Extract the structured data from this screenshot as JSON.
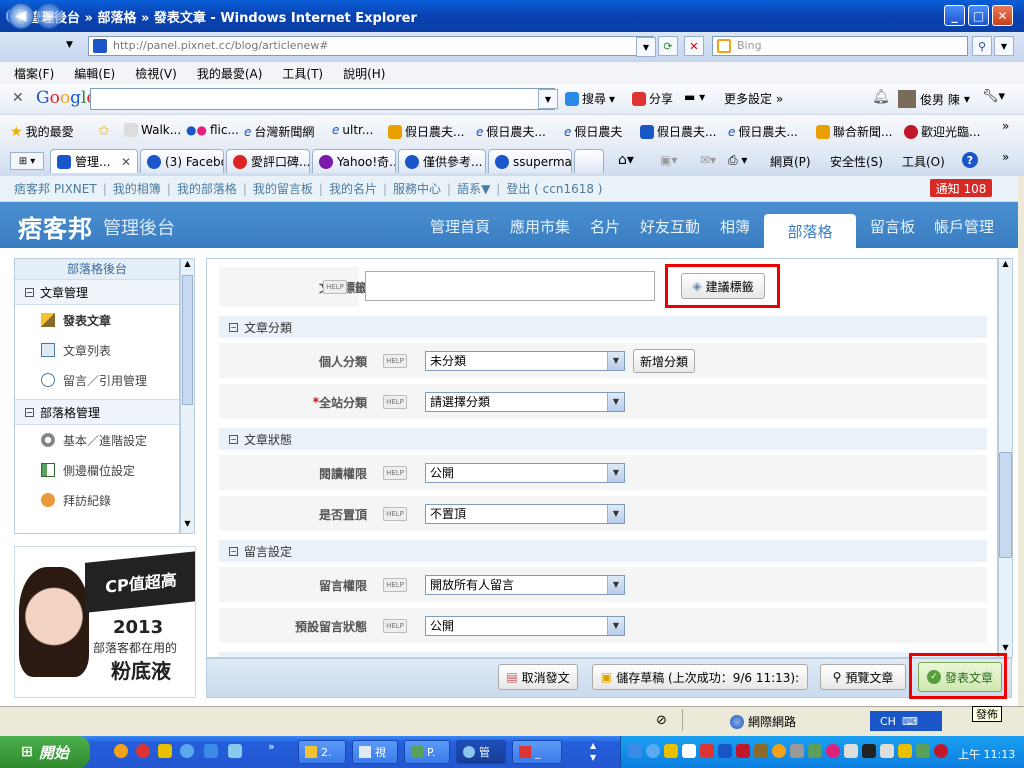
{
  "window": {
    "title": "管理後台 » 部落格 » 發表文章 - Windows Internet Explorer"
  },
  "address": {
    "url": "http://panel.pixnet.cc/blog/articlenew#",
    "search_placeholder": "Bing"
  },
  "menu": [
    "檔案(F)",
    "編輯(E)",
    "檢視(V)",
    "我的最愛(A)",
    "工具(T)",
    "說明(H)"
  ],
  "google_toolbar": {
    "logo": "Google",
    "search_label": "搜尋",
    "share_label": "分享",
    "more_label": "更多設定 »",
    "user_label": "俊男 陳"
  },
  "favorites": {
    "label": "我的最愛",
    "items": [
      "Walk...",
      "flic...",
      "台灣新聞網",
      "ultr...",
      "假日農夫...",
      "假日農夫...",
      "假日農夫",
      "假日農夫...",
      "假日農夫...",
      "聯合新聞...",
      "歡迎光臨..."
    ]
  },
  "tabs": [
    "管理...",
    "(3) Facebo...",
    "愛評口碑...",
    "Yahoo!奇...",
    "僅供參考...",
    "ssuperma..."
  ],
  "ie_commands": {
    "page": "網頁(P)",
    "safety": "安全性(S)",
    "tools": "工具(O)"
  },
  "pixnet_top": {
    "links": [
      "痞客邦 PIXNET",
      "我的相簿",
      "我的部落格",
      "我的留言板",
      "我的名片",
      "服務中心",
      "語系▼",
      "登出 ( ccn1618 )"
    ],
    "notice": "通知 108"
  },
  "pixnet_header": {
    "logo": "痞客邦",
    "subtitle": "管理後台",
    "nav": [
      "管理首頁",
      "應用市集",
      "名片",
      "好友互動",
      "相簿",
      "部落格",
      "留言板",
      "帳戶管理"
    ],
    "active_nav": "部落格"
  },
  "sidebar": {
    "title": "部落格後台",
    "sections": [
      {
        "label": "文章管理",
        "items": [
          "發表文章",
          "文章列表",
          "留言／引用管理"
        ]
      },
      {
        "label": "部落格管理",
        "items": [
          "基本／進階設定",
          "側邊欄位設定",
          "拜訪紀錄"
        ]
      }
    ]
  },
  "ad": {
    "line1": "CP值超高",
    "line2": "2013",
    "line3": "部落客都在用的",
    "line4": "粉底液"
  },
  "form": {
    "help": "HELP",
    "tag": {
      "label": "文章標籤",
      "value": "",
      "suggest_button": "建議標籤"
    },
    "category_section": "文章分類",
    "personal_category": {
      "label": "個人分類",
      "value": "未分類",
      "add_button": "新增分類"
    },
    "site_category": {
      "required": "*",
      "label": "全站分類",
      "value": "請選擇分類"
    },
    "status_section": "文章狀態",
    "read_permission": {
      "label": "閱讀權限",
      "value": "公開"
    },
    "pin": {
      "label": "是否置頂",
      "value": "不置頂"
    },
    "comment_section": "留言設定",
    "comment_permission": {
      "label": "留言權限",
      "value": "開放所有人留言"
    },
    "default_comment_status": {
      "label": "預設留言狀態",
      "value": "公開"
    }
  },
  "actions": {
    "cancel": "取消發文",
    "draft": "儲存草稿 (上次成功：9/6 11:13):",
    "preview": "預覽文章",
    "publish": "發表文章"
  },
  "statusbar": {
    "zone": "網際網路",
    "ime": "CH",
    "tooltip": "發佈"
  },
  "taskbar": {
    "start": "開始",
    "tasks": [
      "2.",
      "視",
      "P.",
      "管",
      "_"
    ],
    "clock": "上午 11:13"
  }
}
